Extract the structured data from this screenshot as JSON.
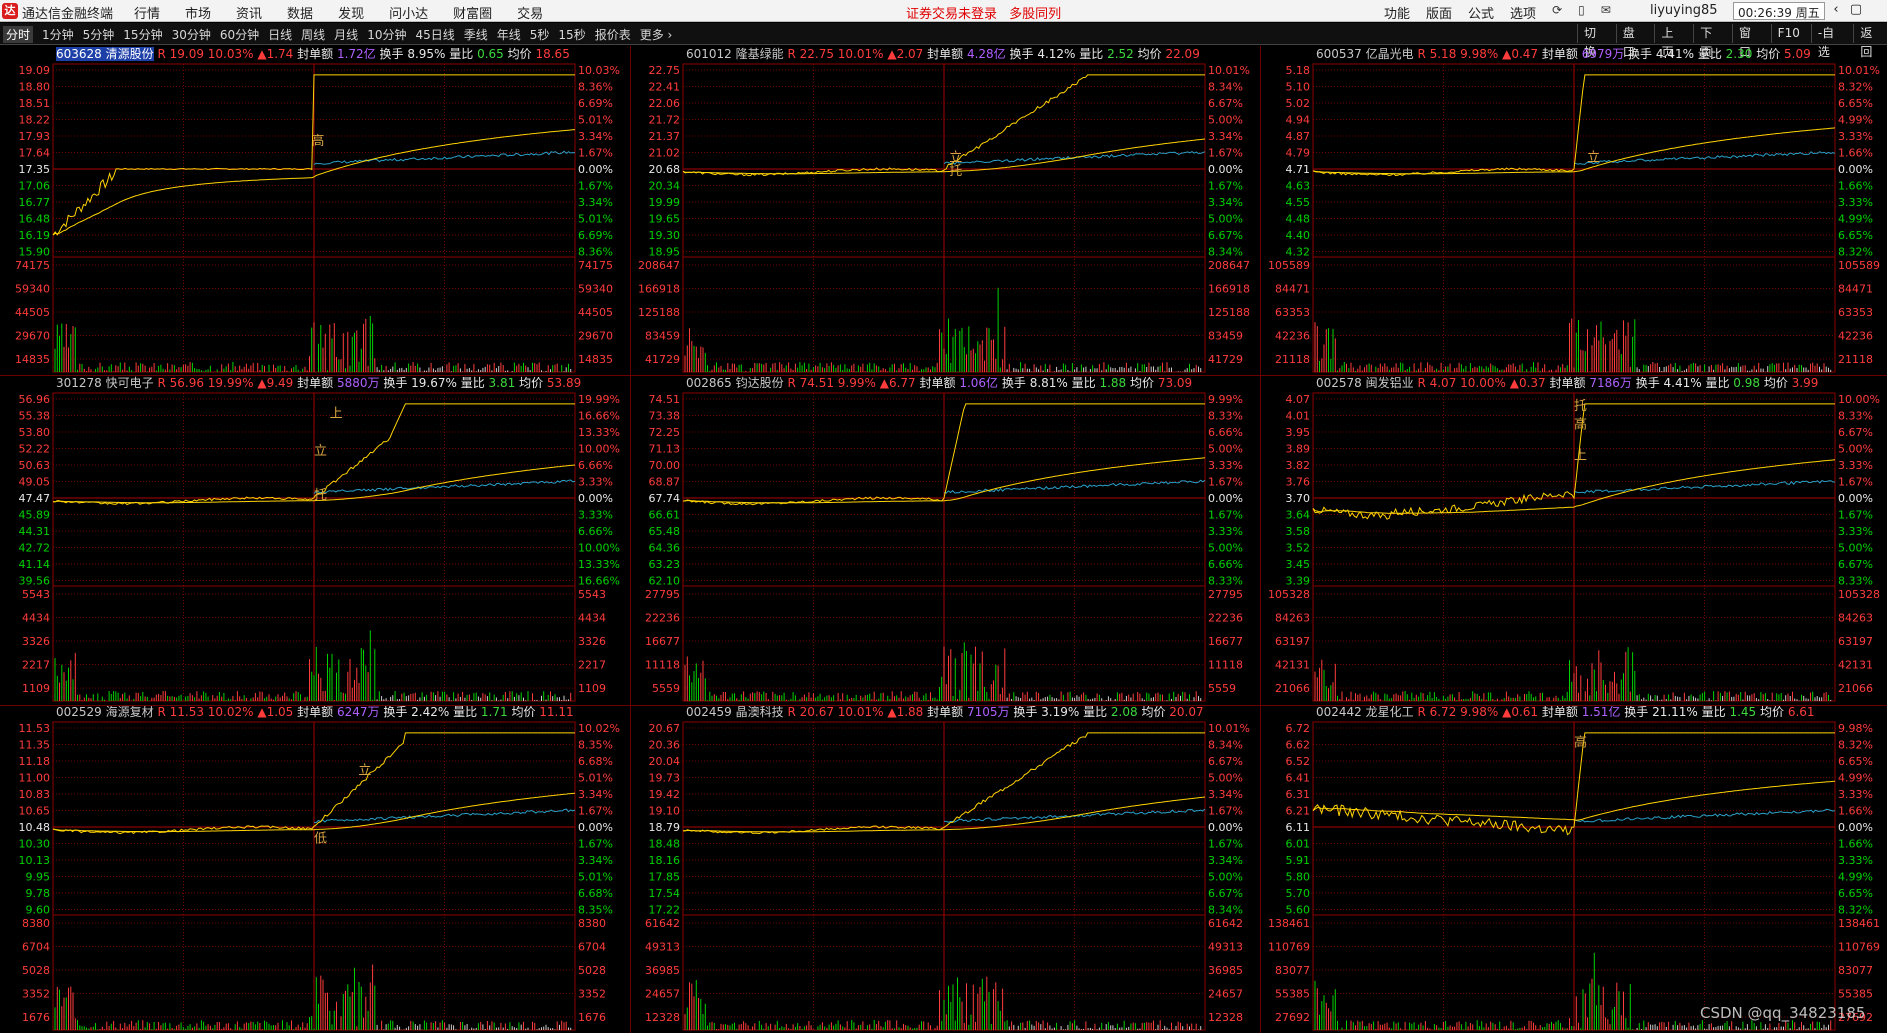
{
  "app": {
    "logo": "达",
    "name": "通达信金融终端"
  },
  "menu": [
    "行情",
    "市场",
    "资讯",
    "数据",
    "发现",
    "问小达",
    "财富圈",
    "交易"
  ],
  "notice": [
    "证券交易未登录",
    "多股同列"
  ],
  "tools": [
    "功能",
    "版面",
    "公式",
    "选项"
  ],
  "tool_icons": [
    "refresh-icon",
    "phone-icon",
    "mail-icon"
  ],
  "user": "liyuying85",
  "clock": "00:26:39 周五",
  "window_buttons": [
    "‹",
    "▢"
  ],
  "periods": [
    "分时",
    "1分钟",
    "5分钟",
    "15分钟",
    "30分钟",
    "60分钟",
    "日线",
    "周线",
    "月线",
    "10分钟",
    "45日线",
    "季线",
    "年线",
    "5秒",
    "15秒",
    "报价表",
    "更多 ›"
  ],
  "active_period": "分时",
  "right_buttons": [
    "切换",
    "盘口",
    "上页",
    "下页",
    "窗口",
    "F10",
    "-自选",
    "返回"
  ],
  "watermark": "CSDN @qq_34823185",
  "colors": {
    "up": "#ff3c3c",
    "down": "#00d200",
    "price": "#e8e8e8",
    "avg": "#ffd400",
    "index_line": "#2aa0c8",
    "code": "#c8c8c8",
    "sealed": "#b060ff",
    "turnover": "#ffffff",
    "grid": "#8b0000",
    "ref": "#d0d0d0"
  },
  "labels": {
    "sealed": "封单额",
    "turnover": "换手",
    "vol_ratio": "量比",
    "avg": "均价",
    "r": "R"
  },
  "stocks": [
    {
      "code": "603628",
      "name": "清源股份",
      "price": "19.09",
      "pct": "10.03%",
      "chg": "▲1.74",
      "sealed": "1.72亿",
      "turnover": "8.95%",
      "vol_ratio": "0.65",
      "avg": "18.65",
      "price_levels": [
        "19.09",
        "18.80",
        "18.51",
        "18.22",
        "17.93",
        "17.64",
        "17.35",
        "17.06",
        "16.77",
        "16.48",
        "16.19",
        "15.90"
      ],
      "pct_levels": [
        "10.03%",
        "8.36%",
        "6.69%",
        "5.01%",
        "3.34%",
        "1.67%",
        "0.00%",
        "1.67%",
        "3.34%",
        "5.01%",
        "6.69%",
        "8.36%"
      ],
      "ref_price": "17.35",
      "vol_levels": [
        "74175",
        "59340",
        "44505",
        "29670",
        "14835"
      ],
      "markers": [
        {
          "text": "高",
          "t": 0.495,
          "pct": 0.03
        }
      ],
      "style": "spike"
    },
    {
      "code": "601012",
      "name": "隆基绿能",
      "price": "22.75",
      "pct": "10.01%",
      "chg": "▲2.07",
      "sealed": "4.28亿",
      "turnover": "4.12%",
      "vol_ratio": "2.52",
      "avg": "22.09",
      "price_levels": [
        "22.75",
        "22.41",
        "22.06",
        "21.72",
        "21.37",
        "21.02",
        "20.68",
        "20.34",
        "19.99",
        "19.65",
        "19.30",
        "18.95"
      ],
      "pct_levels": [
        "10.01%",
        "8.34%",
        "6.67%",
        "5.00%",
        "3.34%",
        "1.67%",
        "0.00%",
        "1.67%",
        "3.34%",
        "5.00%",
        "6.67%",
        "8.34%"
      ],
      "ref_price": "20.68",
      "vol_levels": [
        "208647",
        "166918",
        "125188",
        "83459",
        "41729"
      ],
      "markers": [
        {
          "text": "立",
          "t": 0.51,
          "pct": 0.012
        },
        {
          "text": "托",
          "t": 0.51,
          "pct": -0.002
        }
      ],
      "style": "climb"
    },
    {
      "code": "600537",
      "name": "亿晶光电",
      "price": "5.18",
      "pct": "9.98%",
      "chg": "▲0.47",
      "sealed": "6979万",
      "turnover": "4.41%",
      "vol_ratio": "2.30",
      "avg": "5.09",
      "price_levels": [
        "5.18",
        "5.10",
        "5.02",
        "4.94",
        "4.87",
        "4.79",
        "4.71",
        "4.63",
        "4.55",
        "4.48",
        "4.40",
        "4.32"
      ],
      "pct_levels": [
        "10.01%",
        "8.32%",
        "6.65%",
        "4.99%",
        "3.33%",
        "1.66%",
        "0.00%",
        "1.66%",
        "3.33%",
        "4.99%",
        "6.65%",
        "8.32%"
      ],
      "ref_price": "4.71",
      "vol_levels": [
        "105589",
        "84471",
        "63353",
        "42236",
        "21118"
      ],
      "markers": [
        {
          "text": "立",
          "t": 0.525,
          "pct": 0.012
        }
      ],
      "style": "rocket"
    },
    {
      "code": "301278",
      "name": "快可电子",
      "price": "56.96",
      "pct": "19.99%",
      "chg": "▲9.49",
      "sealed": "5880万",
      "turnover": "19.67%",
      "vol_ratio": "3.81",
      "avg": "53.89",
      "price_levels": [
        "56.96",
        "55.38",
        "53.80",
        "52.22",
        "50.63",
        "49.05",
        "47.47",
        "45.89",
        "44.31",
        "42.72",
        "41.14",
        "39.56"
      ],
      "pct_levels": [
        "19.99%",
        "16.66%",
        "13.33%",
        "10.00%",
        "6.66%",
        "3.33%",
        "0.00%",
        "3.33%",
        "6.66%",
        "10.00%",
        "13.33%",
        "16.66%"
      ],
      "ref_price": "47.47",
      "vol_levels": [
        "5543",
        "4434",
        "3326",
        "2217",
        "1109"
      ],
      "markers": [
        {
          "text": "上",
          "t": 0.53,
          "pct": 0.09
        },
        {
          "text": "立",
          "t": 0.5,
          "pct": 0.05
        },
        {
          "text": "托",
          "t": 0.5,
          "pct": 0.003
        }
      ],
      "style": "steps"
    },
    {
      "code": "002865",
      "name": "钧达股份",
      "price": "74.51",
      "pct": "9.99%",
      "chg": "▲6.77",
      "sealed": "1.06亿",
      "turnover": "8.81%",
      "vol_ratio": "1.88",
      "avg": "73.09",
      "price_levels": [
        "74.51",
        "73.38",
        "72.25",
        "71.13",
        "70.00",
        "68.87",
        "67.74",
        "66.61",
        "65.48",
        "64.36",
        "63.23",
        "62.10"
      ],
      "pct_levels": [
        "9.99%",
        "8.33%",
        "6.66%",
        "5.00%",
        "3.33%",
        "1.67%",
        "0.00%",
        "1.67%",
        "3.33%",
        "5.00%",
        "6.66%",
        "8.33%"
      ],
      "ref_price": "67.74",
      "vol_levels": [
        "27795",
        "22236",
        "16677",
        "11118",
        "5559"
      ],
      "markers": [],
      "style": "rocket2"
    },
    {
      "code": "002578",
      "name": "闽发铝业",
      "price": "4.07",
      "pct": "10.00%",
      "chg": "▲0.37",
      "sealed": "7186万",
      "turnover": "4.41%",
      "vol_ratio": "0.98",
      "avg": "3.99",
      "price_levels": [
        "4.07",
        "4.01",
        "3.95",
        "3.89",
        "3.82",
        "3.76",
        "3.70",
        "3.64",
        "3.58",
        "3.52",
        "3.45",
        "3.39"
      ],
      "pct_levels": [
        "10.00%",
        "8.33%",
        "6.67%",
        "5.00%",
        "3.33%",
        "1.67%",
        "0.00%",
        "1.67%",
        "3.33%",
        "5.00%",
        "6.67%",
        "8.33%"
      ],
      "ref_price": "3.70",
      "vol_levels": [
        "105328",
        "84263",
        "63197",
        "42131",
        "21066"
      ],
      "markers": [
        {
          "text": "托",
          "t": 0.5,
          "pct": 0.098
        },
        {
          "text": "高",
          "t": 0.5,
          "pct": 0.078
        },
        {
          "text": "上",
          "t": 0.5,
          "pct": 0.045
        }
      ],
      "style": "dipjump"
    },
    {
      "code": "002529",
      "name": "海源复材",
      "price": "11.53",
      "pct": "10.02%",
      "chg": "▲1.05",
      "sealed": "6247万",
      "turnover": "2.42%",
      "vol_ratio": "1.71",
      "avg": "11.11",
      "price_levels": [
        "11.53",
        "11.35",
        "11.18",
        "11.00",
        "10.83",
        "10.65",
        "10.48",
        "10.30",
        "10.13",
        "9.95",
        "9.78",
        "9.60"
      ],
      "pct_levels": [
        "10.02%",
        "8.35%",
        "6.68%",
        "5.01%",
        "3.34%",
        "1.67%",
        "0.00%",
        "1.67%",
        "3.34%",
        "5.01%",
        "6.68%",
        "8.35%"
      ],
      "ref_price": "10.48",
      "vol_levels": [
        "8380",
        "6704",
        "5028",
        "3352",
        "1676"
      ],
      "markers": [
        {
          "text": "立",
          "t": 0.585,
          "pct": 0.06
        },
        {
          "text": "低",
          "t": 0.5,
          "pct": -0.012
        }
      ],
      "style": "climb2"
    },
    {
      "code": "002459",
      "name": "晶澳科技",
      "price": "20.67",
      "pct": "10.01%",
      "chg": "▲1.88",
      "sealed": "7105万",
      "turnover": "3.19%",
      "vol_ratio": "2.08",
      "avg": "20.07",
      "price_levels": [
        "20.67",
        "20.36",
        "20.04",
        "19.73",
        "19.42",
        "19.10",
        "18.79",
        "18.48",
        "18.16",
        "17.85",
        "17.54",
        "17.22"
      ],
      "pct_levels": [
        "10.01%",
        "8.34%",
        "6.67%",
        "5.00%",
        "3.34%",
        "1.67%",
        "0.00%",
        "1.67%",
        "3.34%",
        "5.00%",
        "6.67%",
        "8.34%"
      ],
      "ref_price": "18.79",
      "vol_levels": [
        "61642",
        "49313",
        "36985",
        "24657",
        "12328"
      ],
      "markers": [],
      "style": "climb"
    },
    {
      "code": "002442",
      "name": "龙星化工",
      "price": "6.72",
      "pct": "9.98%",
      "chg": "▲0.61",
      "sealed": "1.51亿",
      "turnover": "21.11%",
      "vol_ratio": "1.45",
      "avg": "6.61",
      "price_levels": [
        "6.72",
        "6.62",
        "6.52",
        "6.41",
        "6.31",
        "6.21",
        "6.11",
        "6.01",
        "5.91",
        "5.80",
        "5.70",
        "5.60"
      ],
      "pct_levels": [
        "9.98%",
        "8.32%",
        "6.65%",
        "4.99%",
        "3.33%",
        "1.66%",
        "0.00%",
        "1.66%",
        "3.33%",
        "4.99%",
        "6.65%",
        "8.32%"
      ],
      "ref_price": "6.11",
      "vol_levels": [
        "138461",
        "110769",
        "83077",
        "55385",
        "27692"
      ],
      "markers": [
        {
          "text": "高",
          "t": 0.5,
          "pct": 0.09
        }
      ],
      "style": "fade"
    }
  ]
}
